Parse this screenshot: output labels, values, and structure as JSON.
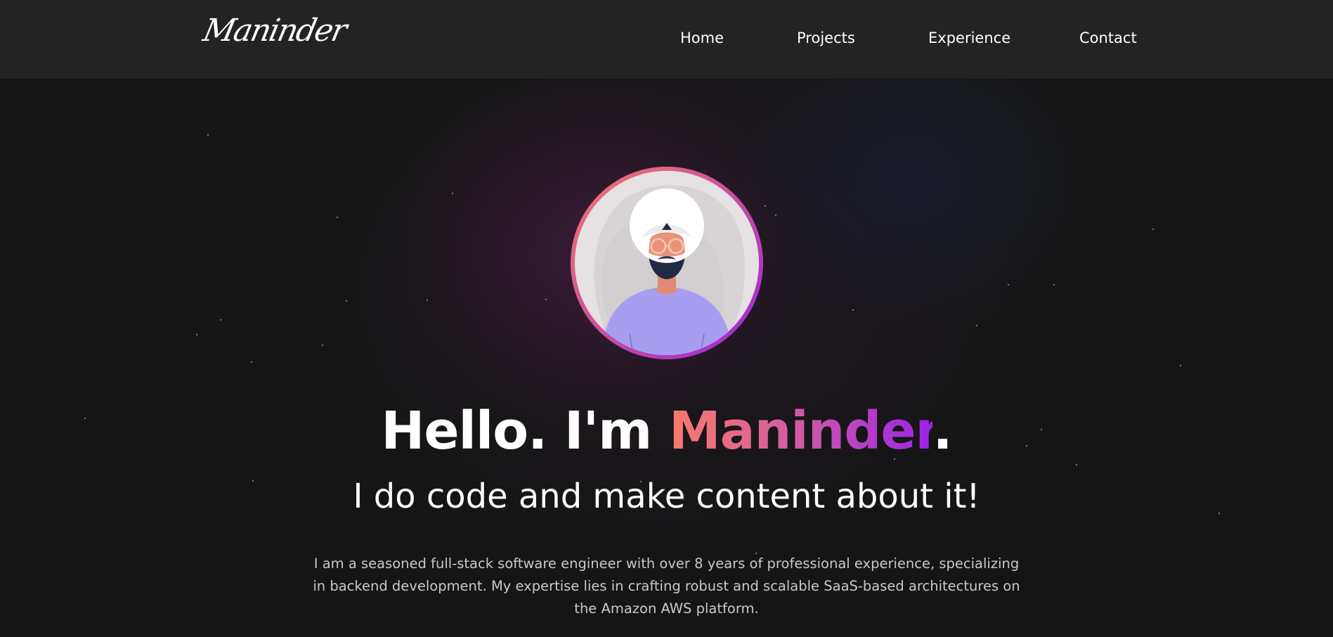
{
  "header": {
    "logo_text": "Maninder",
    "nav": {
      "home": "Home",
      "projects": "Projects",
      "experience": "Experience",
      "contact": "Contact"
    }
  },
  "hero": {
    "greeting_prefix": "Hello. I'm ",
    "name": "Maninder",
    "greeting_suffix": ".",
    "tagline": "I do code and make content about it!",
    "bio": "I am a seasoned full-stack software engineer with over 8 years of professional experience, specializing in backend development. My expertise lies in crafting robust and scalable SaaS-based architectures on the Amazon AWS platform.",
    "avatar_icon": "person-with-turban-avatar"
  },
  "colors": {
    "header_bg": "#232323",
    "page_bg": "#151515",
    "accent_start": "#f77a6a",
    "accent_end": "#9b23e6"
  }
}
